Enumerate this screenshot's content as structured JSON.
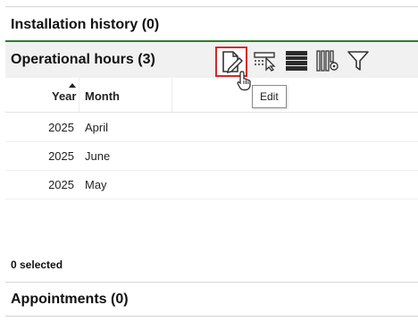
{
  "installation_history": {
    "title": "Installation history (0)"
  },
  "operational_hours": {
    "title": "Operational hours (3)",
    "toolbar": [
      {
        "name": "edit",
        "icon": "edit-document-icon",
        "highlighted": true
      },
      {
        "name": "select",
        "icon": "select-cursor-icon"
      },
      {
        "name": "rows",
        "icon": "row-list-icon"
      },
      {
        "name": "columns",
        "icon": "column-settings-icon"
      },
      {
        "name": "filter",
        "icon": "filter-funnel-icon"
      }
    ],
    "tooltip": "Edit",
    "columns": {
      "year": "Year",
      "month": "Month"
    },
    "sort": {
      "column": "year",
      "direction": "ascending"
    },
    "rows": [
      {
        "year": "2025",
        "month": "April"
      },
      {
        "year": "2025",
        "month": "June"
      },
      {
        "year": "2025",
        "month": "May"
      }
    ],
    "selected_text": "0 selected"
  },
  "appointments": {
    "title": "Appointments (0)"
  },
  "colors": {
    "accent_green": "#2e7d32",
    "highlight_red": "#d62828",
    "header_bg": "#f1f1f1"
  }
}
